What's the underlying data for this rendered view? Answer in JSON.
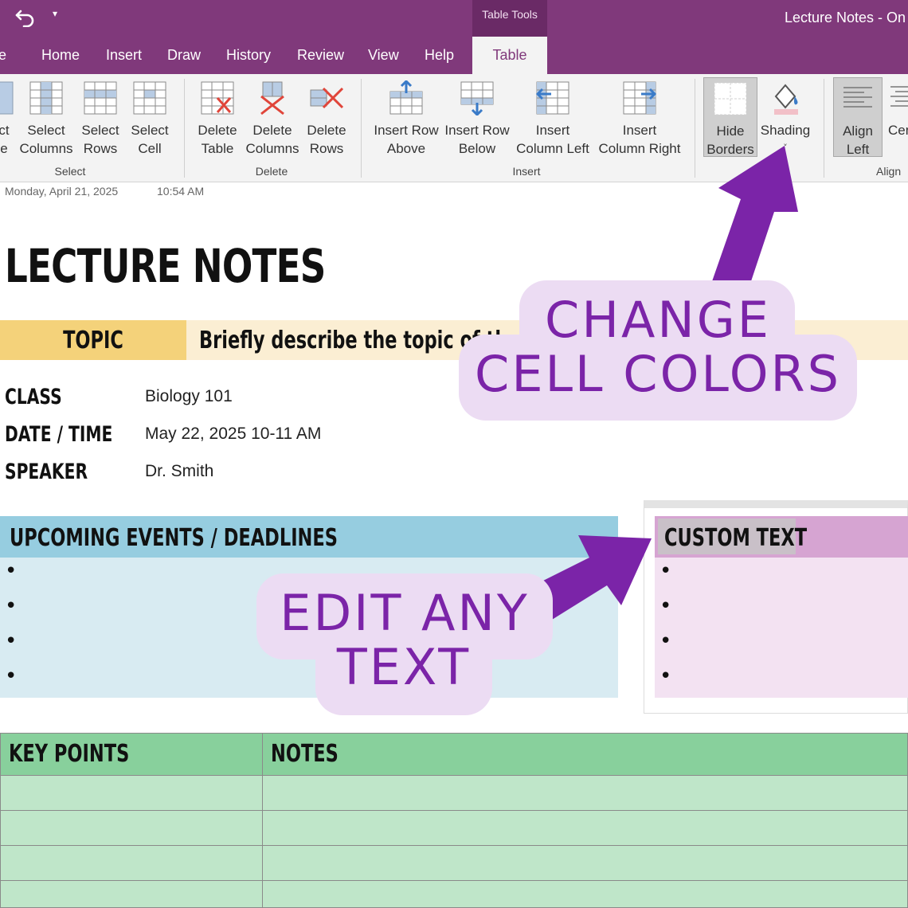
{
  "titlebar": {
    "context_label": "Table Tools",
    "window_title": "Lecture Notes  -  On"
  },
  "tabs": [
    {
      "label": "e",
      "name": "tab-file"
    },
    {
      "label": "Home",
      "name": "tab-home"
    },
    {
      "label": "Insert",
      "name": "tab-insert"
    },
    {
      "label": "Draw",
      "name": "tab-draw"
    },
    {
      "label": "History",
      "name": "tab-history"
    },
    {
      "label": "Review",
      "name": "tab-review"
    },
    {
      "label": "View",
      "name": "tab-view"
    },
    {
      "label": "Help",
      "name": "tab-help"
    }
  ],
  "active_tab": "Table",
  "ribbon": {
    "select_group": "Select",
    "delete_group": "Delete",
    "insert_group": "Insert",
    "align_group": "Align",
    "buttons": {
      "select_table": "ct\ne",
      "select_columns": "Select\nColumns",
      "select_rows": "Select\nRows",
      "select_cell": "Select\nCell",
      "delete_table": "Delete\nTable",
      "delete_columns": "Delete\nColumns",
      "delete_rows": "Delete\nRows",
      "insert_above": "Insert Row\nAbove",
      "insert_below": "Insert Row\nBelow",
      "insert_left": "Insert\nColumn Left",
      "insert_right": "Insert\nColumn Right",
      "hide_borders": "Hide\nBorders",
      "shading": "Shading",
      "align_left": "Align\nLeft",
      "center": "Cen"
    }
  },
  "page": {
    "date": "Monday, April 21, 2025",
    "time": "10:54 AM",
    "title": "LECTURE NOTES",
    "topic_label": "TOPIC",
    "topic_value": "Briefly describe the topic of the l",
    "class_label": "CLASS",
    "class_value": "Biology 101",
    "datetime_label": "DATE / TIME",
    "datetime_value": "May 22, 2025 10-11 AM",
    "speaker_label": "SPEAKER",
    "speaker_value": "Dr. Smith",
    "events_heading": "UPCOMING EVENTS / DEADLINES",
    "custom_heading": "CUSTOM TEXT",
    "bullet": "•",
    "key_points_heading": "KEY POINTS",
    "notes_heading": "NOTES"
  },
  "callouts": {
    "change_line1": "CHANGE",
    "change_line2": "CELL COLORS",
    "edit_line1": "EDIT ANY",
    "edit_line2": "TEXT"
  },
  "colors": {
    "brand": "#80397b",
    "callout_text": "#7b24a8",
    "callout_bg": "#ecdcf3",
    "arrow": "#7b24a8"
  }
}
